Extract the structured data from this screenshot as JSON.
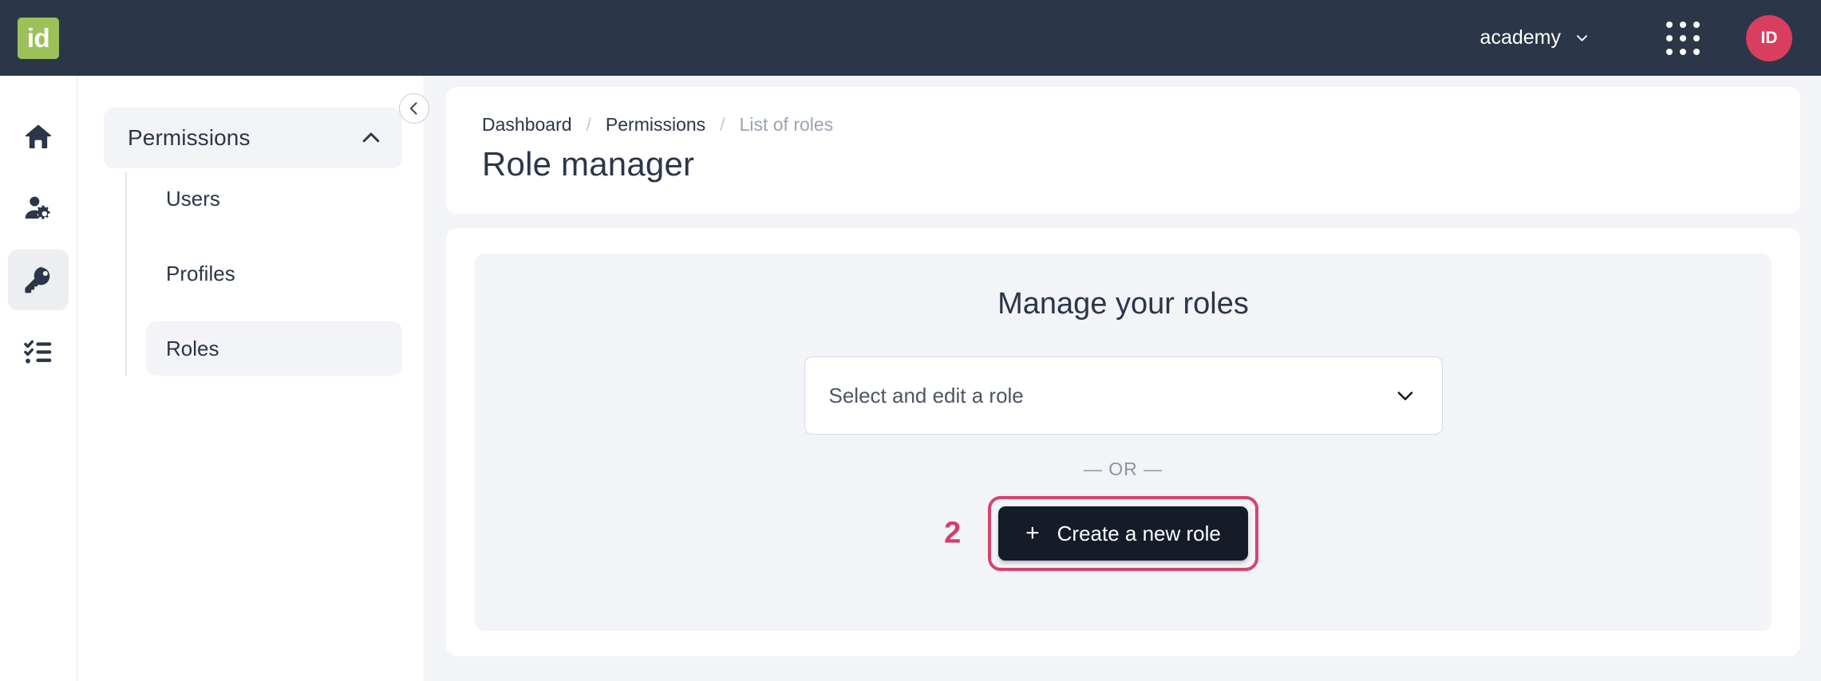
{
  "topbar": {
    "logo_text": "id",
    "tenant_label": "academy",
    "tenant_chevron_icon": "chevron-down-icon",
    "apps_grid_icon": "apps-grid-icon",
    "avatar_initials": "ID"
  },
  "rail": {
    "items": [
      {
        "icon": "home-icon",
        "name": "home",
        "active": false
      },
      {
        "icon": "user-gear-icon",
        "name": "user-management",
        "active": false
      },
      {
        "icon": "key-icon",
        "name": "permissions",
        "active": true
      },
      {
        "icon": "task-list-icon",
        "name": "tasks",
        "active": false
      }
    ]
  },
  "sidebar": {
    "group": {
      "label": "Permissions",
      "chevron_icon": "chevron-up-icon",
      "expanded": true
    },
    "children": [
      {
        "label": "Users",
        "active": false
      },
      {
        "label": "Profiles",
        "active": false
      },
      {
        "label": "Roles",
        "active": true
      }
    ],
    "collapse_icon": "chevron-left-icon"
  },
  "header": {
    "breadcrumb": [
      {
        "label": "Dashboard",
        "muted": false
      },
      {
        "label": "Permissions",
        "muted": false
      },
      {
        "label": "List of roles",
        "muted": true
      }
    ],
    "separator": "/",
    "title": "Role manager"
  },
  "main": {
    "panel_title": "Manage your roles",
    "select": {
      "placeholder": "Select and edit a role",
      "value": "Select and edit a role",
      "chevron_icon": "chevron-down-icon"
    },
    "or_text": "— OR —",
    "cta": {
      "plus_icon": "plus-icon",
      "label": "Create a new role",
      "step_number": "2"
    }
  },
  "colors": {
    "topbar_bg": "#2b3648",
    "logo_bg": "#9cc159",
    "avatar_bg": "#da3e5f",
    "accent_pink": "#d8436f",
    "content_bg": "#f2f4f7",
    "cta_bg": "#151c28"
  }
}
